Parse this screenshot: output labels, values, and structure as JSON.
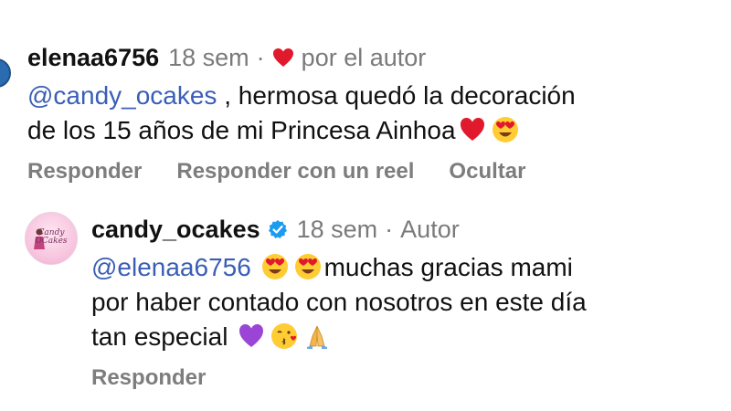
{
  "comment": {
    "username": "elenaa6756",
    "time": "18 sem",
    "dot": "·",
    "liked_by_author": "por el autor",
    "mention": "@candy_ocakes",
    "text_line1": " , hermosa quedó la decoración",
    "text_line2": "de los 15 años de mi Princesa Ainhoa",
    "actions": {
      "reply": "Responder",
      "reply_with_reel": "Responder con un reel",
      "hide": "Ocultar"
    }
  },
  "reply": {
    "username": "candy_ocakes",
    "time": "18 sem",
    "dot": "·",
    "role": "Autor",
    "mention": "@elenaa6756",
    "text_line1": "muchas gracias mami",
    "text_line2": "por haber contado con nosotros en este día",
    "text_line3": "tan especial",
    "avatar_text": "Candy OCakes",
    "actions": {
      "reply": "Responder"
    }
  },
  "colors": {
    "mention": "#3a5eb6",
    "heart": "#e0192c",
    "verified": "#1d9bf0",
    "meta": "#7a7a7a"
  }
}
